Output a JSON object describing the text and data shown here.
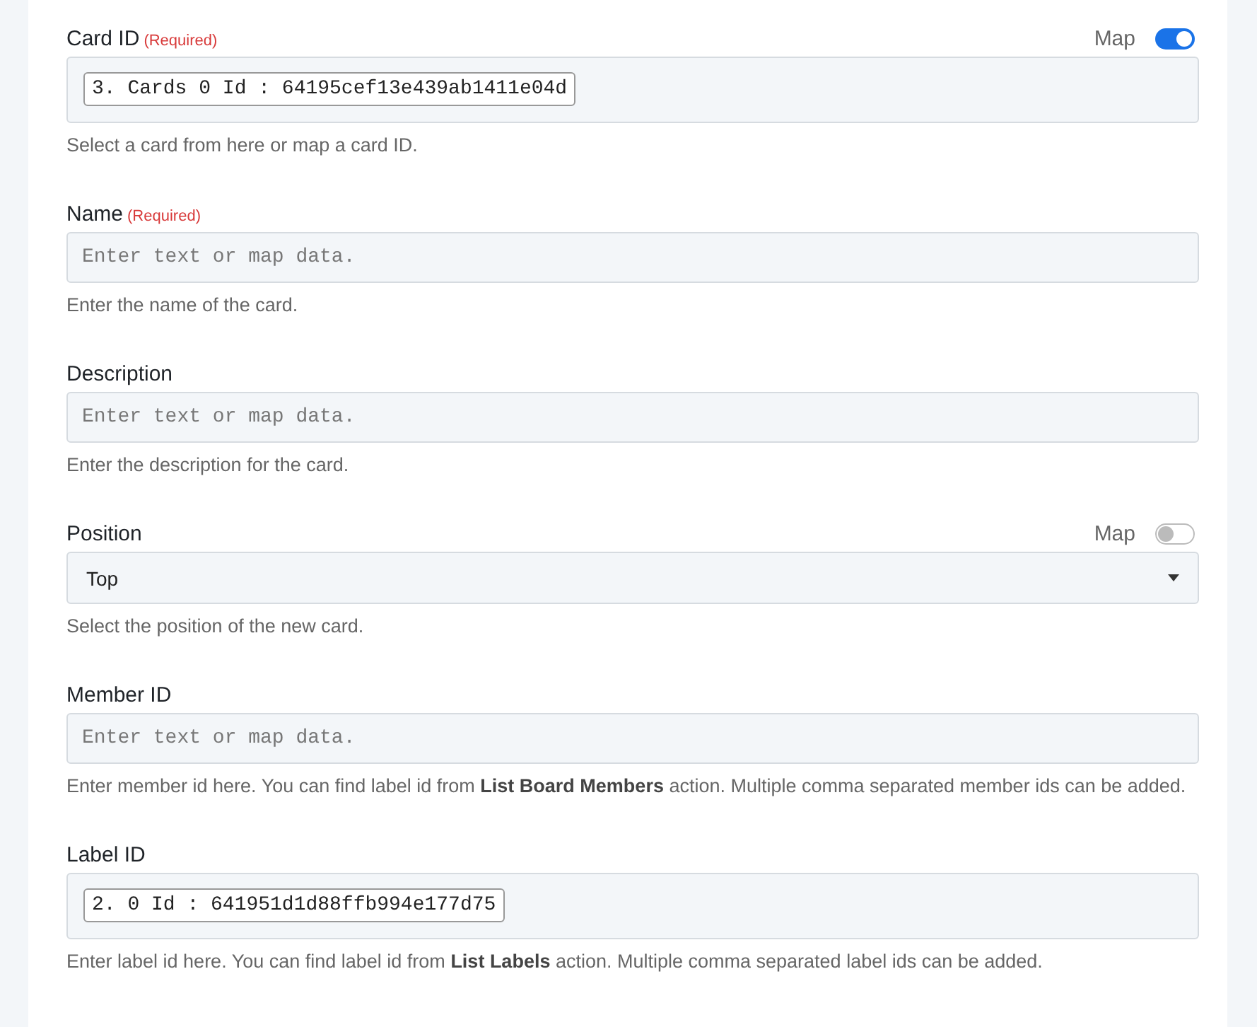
{
  "fields": [
    {
      "label": "Card ID",
      "required": "(Required)",
      "map": {
        "label": "Map",
        "on": true
      },
      "kind": "token",
      "value": "3. Cards 0 Id : 64195cef13e439ab1411e04d",
      "help": "Select a card from here or map a card ID."
    },
    {
      "label": "Name",
      "required": "(Required)",
      "kind": "text",
      "placeholder": "Enter text or map data.",
      "help": "Enter the name of the card."
    },
    {
      "label": "Description",
      "kind": "text",
      "placeholder": "Enter text or map data.",
      "help": "Enter the description for the card."
    },
    {
      "label": "Position",
      "map": {
        "label": "Map",
        "on": false
      },
      "kind": "select",
      "value": "Top",
      "help": "Select the position of the new card."
    },
    {
      "label": "Member ID",
      "kind": "text",
      "placeholder": "Enter text or map data.",
      "help": "Enter member id here. You can find label id from **List Board Members** action. Multiple comma separated member ids can be added."
    },
    {
      "label": "Label ID",
      "kind": "token",
      "value": "2. 0 Id : 641951d1d88ffb994e177d75",
      "help": "Enter label id here. You can find label id from **List Labels** action. Multiple comma separated label ids can be added."
    }
  ]
}
